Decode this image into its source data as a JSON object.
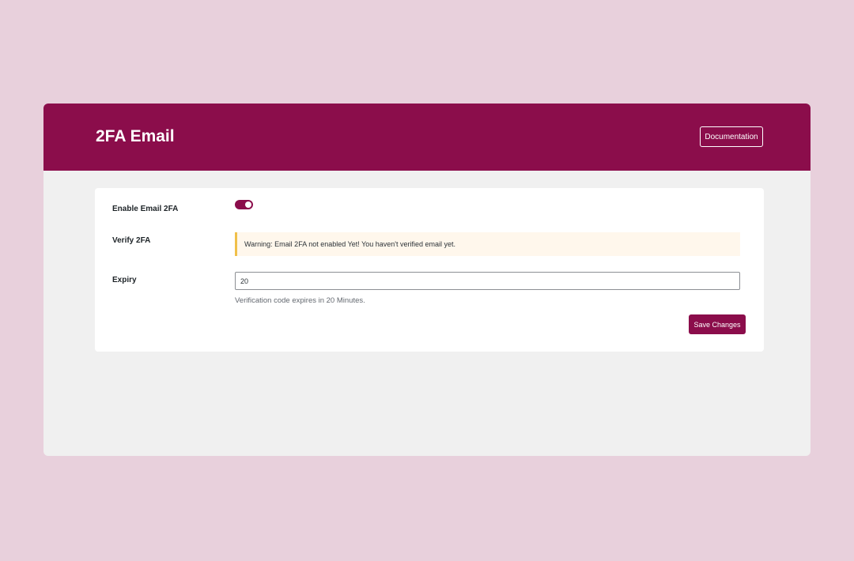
{
  "header": {
    "title": "2FA Email",
    "documentation_label": "Documentation"
  },
  "settings": {
    "enable": {
      "label": "Enable Email 2FA",
      "toggle_on": true
    },
    "verify": {
      "label": "Verify 2FA",
      "warning": "Warning: Email 2FA not enabled Yet! You haven't verified email yet."
    },
    "expiry": {
      "label": "Expiry",
      "value": "20",
      "help": "Verification code expires in 20 Minutes."
    },
    "save_label": "Save Changes"
  },
  "colors": {
    "brand": "#8b0d4b",
    "background": "#e8d0dc",
    "warning_border": "#f0c04a",
    "warning_bg": "#fff7ec"
  }
}
